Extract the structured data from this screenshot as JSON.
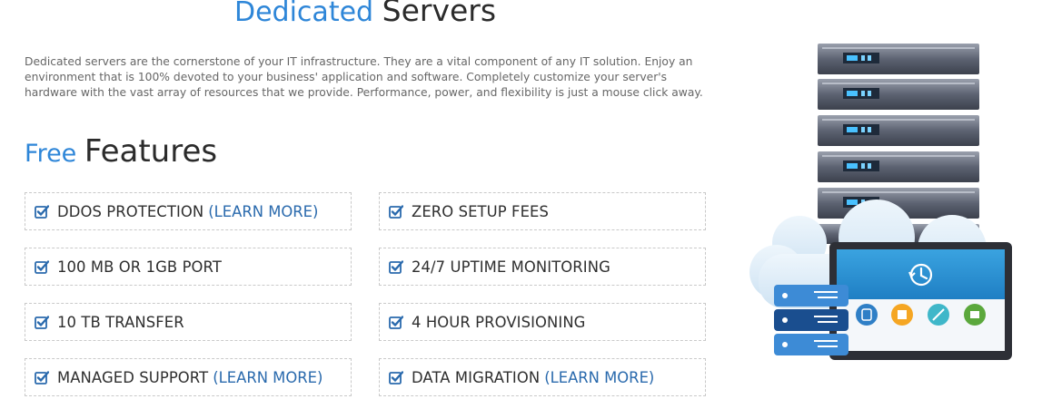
{
  "title": {
    "accent": "Dedicated",
    "main": "Servers"
  },
  "intro": "Dedicated servers are the cornerstone of your IT infrastructure. They are a vital component of any IT solution. Enjoy an environment that is 100% devoted to your business' application and software. Completely customize your server's hardware with the vast array of resources that we provide. Performance, power, and flexibility is just a mouse click away.",
  "features_heading": {
    "accent": "Free",
    "main": "Features"
  },
  "features": [
    {
      "label": "DDOS PROTECTION",
      "link": "(LEARN MORE)"
    },
    {
      "label": "ZERO SETUP FEES",
      "link": ""
    },
    {
      "label": "100 MB OR 1GB PORT",
      "link": ""
    },
    {
      "label": "24/7 UPTIME MONITORING",
      "link": ""
    },
    {
      "label": "10 TB TRANSFER",
      "link": ""
    },
    {
      "label": "4 HOUR PROVISIONING",
      "link": ""
    },
    {
      "label": "MANAGED SUPPORT",
      "link": "(LEARN MORE)"
    },
    {
      "label": "DATA MIGRATION",
      "link": "(LEARN MORE)"
    }
  ],
  "colors": {
    "accent": "#2e86d8",
    "link": "#2a6aad",
    "check": "#2a6aad",
    "text": "#2f2f2f"
  },
  "icons": {
    "check": "checkbox-check-icon",
    "history": "history-clock-icon"
  }
}
